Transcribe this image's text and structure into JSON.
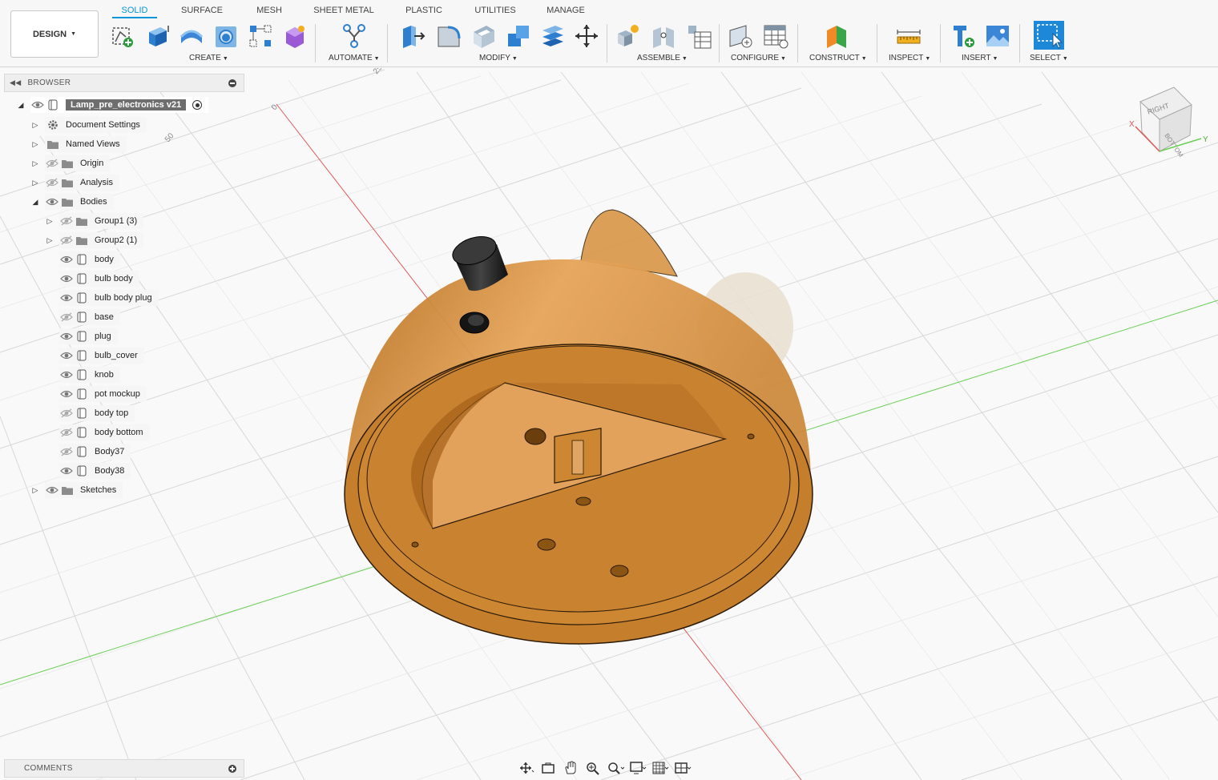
{
  "toolbar": {
    "workspace": "DESIGN",
    "tabs": [
      "SOLID",
      "SURFACE",
      "MESH",
      "SHEET METAL",
      "PLASTIC",
      "UTILITIES",
      "MANAGE"
    ],
    "groups": {
      "create": "CREATE",
      "automate": "AUTOMATE",
      "modify": "MODIFY",
      "assemble": "ASSEMBLE",
      "configure": "CONFIGURE",
      "construct": "CONSTRUCT",
      "inspect": "INSPECT",
      "insert": "INSERT",
      "select": "SELECT"
    },
    "accent_color": "#0696d7"
  },
  "browser": {
    "title": "BROWSER",
    "root": "Lamp_pre_electronics v21",
    "items": [
      {
        "label": "Document Settings",
        "icon": "gear-icon"
      },
      {
        "label": "Named Views",
        "icon": "folder-icon"
      },
      {
        "label": "Origin",
        "icon": "folder-icon",
        "visible": false
      },
      {
        "label": "Analysis",
        "icon": "folder-icon",
        "visible": false
      },
      {
        "label": "Bodies",
        "icon": "folder-icon",
        "visible": true,
        "expanded": true
      },
      {
        "label": "Group1 (3)",
        "icon": "folder-icon",
        "visible": false
      },
      {
        "label": "Group2 (1)",
        "icon": "folder-icon",
        "visible": false
      },
      {
        "label": "body",
        "icon": "body-icon",
        "visible": true
      },
      {
        "label": "bulb body",
        "icon": "body-icon",
        "visible": true
      },
      {
        "label": "bulb body plug",
        "icon": "body-icon",
        "visible": true
      },
      {
        "label": "base",
        "icon": "body-icon",
        "visible": false
      },
      {
        "label": "plug",
        "icon": "body-icon",
        "visible": true
      },
      {
        "label": "bulb_cover",
        "icon": "body-icon",
        "visible": true
      },
      {
        "label": "knob",
        "icon": "body-icon",
        "visible": true
      },
      {
        "label": "pot mockup",
        "icon": "body-icon",
        "visible": true
      },
      {
        "label": "body top",
        "icon": "body-icon",
        "visible": false
      },
      {
        "label": "body bottom",
        "icon": "body-icon",
        "visible": false
      },
      {
        "label": "Body37",
        "icon": "body-icon",
        "visible": false
      },
      {
        "label": "Body38",
        "icon": "body-icon",
        "visible": true
      },
      {
        "label": "Sketches",
        "icon": "folder-icon",
        "visible": true
      }
    ]
  },
  "comments": {
    "title": "COMMENTS"
  },
  "viewcube": {
    "right": "RIGHT",
    "bottom": "BOTTOM",
    "x": "X",
    "y": "Y"
  },
  "viewport": {
    "grid_labels": [
      "25",
      "0",
      "50"
    ],
    "model_color": "#c8822d"
  }
}
